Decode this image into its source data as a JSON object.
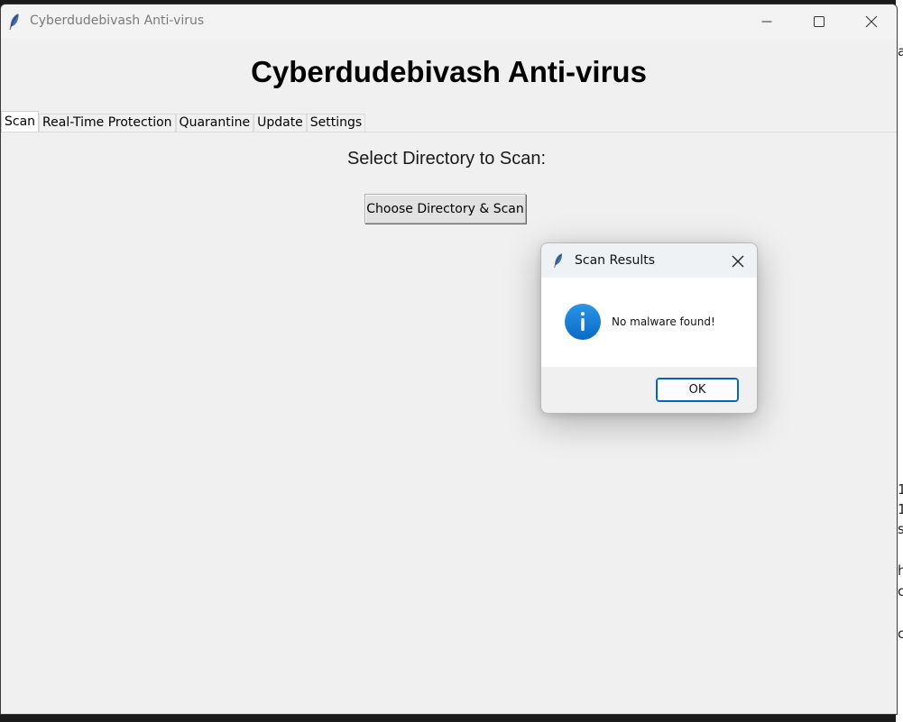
{
  "window": {
    "title": "Cyberdudebivash Anti-virus",
    "icon": "feather-icon"
  },
  "main": {
    "heading": "Cyberdudebivash Anti-virus",
    "tabs": [
      {
        "label": "Scan",
        "active": true
      },
      {
        "label": "Real-Time Protection",
        "active": false
      },
      {
        "label": "Quarantine",
        "active": false
      },
      {
        "label": "Update",
        "active": false
      },
      {
        "label": "Settings",
        "active": false
      }
    ],
    "select_label": "Select Directory to Scan:",
    "choose_button": "Choose Directory & Scan"
  },
  "dialog": {
    "title": "Scan Results",
    "icon": "info-icon",
    "message": "No malware found!",
    "ok_label": "OK"
  },
  "background_fragments": [
    "a",
    "1",
    "1",
    "s",
    "h",
    "c",
    "c"
  ],
  "colors": {
    "window_bg": "#f0f0f0",
    "info_blue": "#0a78d4",
    "ok_border": "#0067c0"
  }
}
